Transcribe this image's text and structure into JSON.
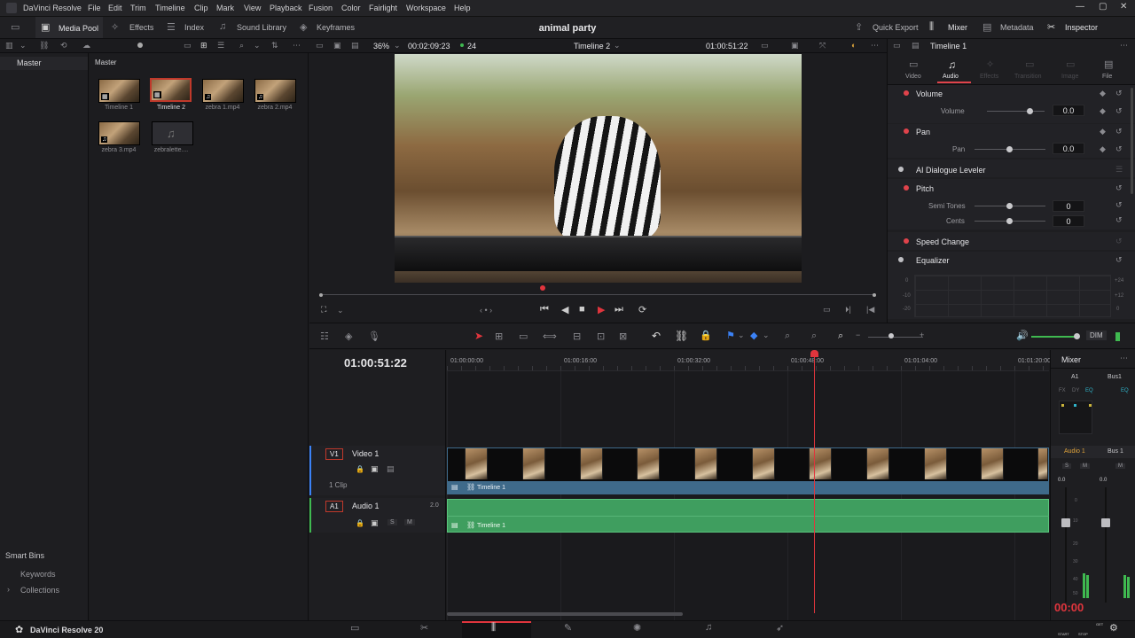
{
  "app": {
    "name": "DaVinci Resolve",
    "version_label": "DaVinci Resolve 20"
  },
  "menu": [
    "DaVinci Resolve",
    "File",
    "Edit",
    "Trim",
    "Timeline",
    "Clip",
    "Mark",
    "View",
    "Playback",
    "Fusion",
    "Color",
    "Fairlight",
    "Workspace",
    "Help"
  ],
  "toolbar": {
    "media_pool": "Media Pool",
    "effects": "Effects",
    "index": "Index",
    "sound_library": "Sound Library",
    "keyframes": "Keyframes",
    "project_title": "animal party",
    "quick_export": "Quick Export",
    "mixer": "Mixer",
    "metadata": "Metadata",
    "inspector": "Inspector"
  },
  "left_panel": {
    "master": "Master",
    "smart_bins": "Smart Bins",
    "keywords": "Keywords",
    "collections": "Collections"
  },
  "media_pool": {
    "header": "Master",
    "clips": [
      {
        "name": "Timeline 1",
        "type": "timeline"
      },
      {
        "name": "Timeline 2",
        "type": "timeline",
        "selected": true
      },
      {
        "name": "zebra 1.mp4",
        "type": "audio-video"
      },
      {
        "name": "zebra 2.mp4",
        "type": "audio-video"
      },
      {
        "name": "zebra 3.mp4",
        "type": "audio-video"
      },
      {
        "name": "zebralette....",
        "type": "audio"
      }
    ]
  },
  "viewer": {
    "zoom": "36%",
    "duration": "00:02:09:23",
    "fps": "24",
    "timeline_name": "Timeline 2",
    "timecode": "01:00:51:22"
  },
  "inspector": {
    "title": "Timeline 1",
    "tabs": [
      "Video",
      "Audio",
      "Effects",
      "Transition",
      "Image",
      "File"
    ],
    "active_tab": "Audio",
    "volume": {
      "label": "Volume",
      "param": "Volume",
      "value": "0.0"
    },
    "pan": {
      "label": "Pan",
      "param": "Pan",
      "value": "0.0"
    },
    "ai_leveler": "AI Dialogue Leveler",
    "pitch": {
      "label": "Pitch",
      "semi_label": "Semi Tones",
      "semi_value": "0",
      "cents_label": "Cents",
      "cents_value": "0"
    },
    "speed_change": "Speed Change",
    "equalizer": {
      "label": "Equalizer",
      "left_ticks": [
        "0",
        "-10",
        "-20"
      ],
      "right_ticks": [
        "+24",
        "+12",
        "0"
      ]
    }
  },
  "timeline": {
    "timecode": "01:00:51:22",
    "ruler": [
      "01:00:00:00",
      "01:00:16:00",
      "01:00:32:00",
      "01:00:48:00",
      "01:01:04:00",
      "01:01:20:00"
    ],
    "dim_label": "DIM",
    "video_track": {
      "id": "V1",
      "name": "Video 1",
      "clip_count": "1 Clip",
      "clip_label": "Timeline 1"
    },
    "audio_track": {
      "id": "A1",
      "name": "Audio 1",
      "level": "2.0",
      "clip_label": "Timeline 1",
      "solo": "S",
      "mute": "M"
    }
  },
  "mixer": {
    "title": "Mixer",
    "col1": "A1",
    "col2": "Bus1",
    "fx": "FX",
    "dy": "DY",
    "eq": "EQ",
    "chan1": "Audio 1",
    "chan2": "Bus 1",
    "s": "S",
    "m": "M",
    "val1": "0.0",
    "val2": "0.0",
    "timer": "00:00",
    "start": "START",
    "stop": "STOP",
    "get": "GET",
    "meter_ticks": [
      "0",
      "5",
      "10",
      "15",
      "20",
      "30",
      "40",
      "50"
    ]
  },
  "colors": {
    "accent_red": "#e0434b",
    "video_clip": "#3f6a8a",
    "audio_clip": "#3f9e5f",
    "playhead": "#e0353d"
  }
}
